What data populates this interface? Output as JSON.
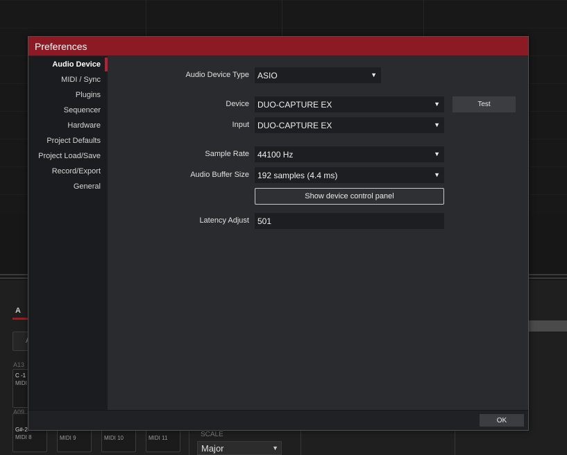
{
  "background": {
    "tab_label": "A",
    "square_letter": "A",
    "row_labels": [
      "A13",
      "A09"
    ],
    "pads_top": [
      {
        "note": "C -1",
        "midi": "MIDI"
      }
    ],
    "pads_bottom": [
      {
        "note": "G#-2",
        "midi": "MIDI 8"
      },
      {
        "note": "",
        "midi": "MIDI 9"
      },
      {
        "note": "",
        "midi": "MIDI 10"
      },
      {
        "note": "",
        "midi": "MIDI 11"
      }
    ],
    "scale_label": "SCALE",
    "scale_value": "Major"
  },
  "dialog": {
    "title": "Preferences",
    "sidebar": {
      "items": [
        {
          "label": "Audio Device",
          "active": true
        },
        {
          "label": "MIDI / Sync",
          "active": false
        },
        {
          "label": "Plugins",
          "active": false
        },
        {
          "label": "Sequencer",
          "active": false
        },
        {
          "label": "Hardware",
          "active": false
        },
        {
          "label": "Project Defaults",
          "active": false
        },
        {
          "label": "Project Load/Save",
          "active": false
        },
        {
          "label": "Record/Export",
          "active": false
        },
        {
          "label": "General",
          "active": false
        }
      ]
    },
    "audio": {
      "device_type_label": "Audio Device Type",
      "device_type_value": "ASIO",
      "device_label": "Device",
      "device_value": "DUO-CAPTURE EX",
      "test_label": "Test",
      "input_label": "Input",
      "input_value": "DUO-CAPTURE EX",
      "sample_rate_label": "Sample Rate",
      "sample_rate_value": "44100 Hz",
      "buffer_label": "Audio Buffer Size",
      "buffer_value": "192 samples (4.4 ms)",
      "control_panel_label": "Show device control panel",
      "latency_label": "Latency Adjust",
      "latency_value": "501"
    },
    "ok_label": "OK"
  },
  "colors": {
    "title_bar": "#8c1a24",
    "accent": "#b8202d"
  }
}
